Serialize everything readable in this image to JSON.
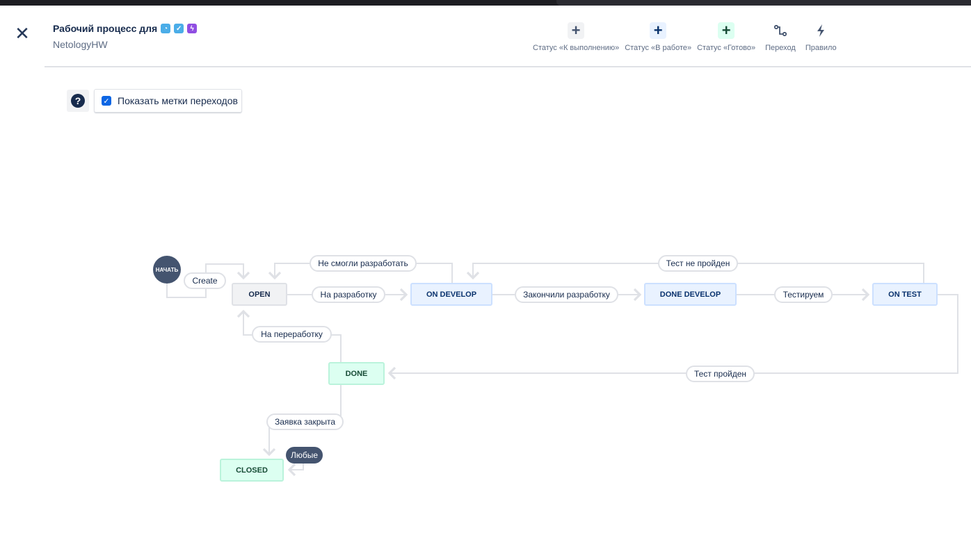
{
  "header": {
    "close_icon": "close-icon",
    "title": "Рабочий процесс для",
    "issue_type_icons": [
      "subtask-icon",
      "task-icon",
      "epic-icon"
    ],
    "project": "NetologyHW"
  },
  "toolbar": [
    {
      "label": "Статус «К выполнению»",
      "icon": "plus-icon",
      "color": "#44546f",
      "bg": "#f1f2f4"
    },
    {
      "label": "Статус «В работе»",
      "icon": "plus-icon",
      "color": "#09326c",
      "bg": "#e9f2ff"
    },
    {
      "label": "Статус «Готово»",
      "icon": "plus-icon",
      "color": "#164b35",
      "bg": "#dcfff1"
    },
    {
      "label": "Переход",
      "icon": "transition-icon"
    },
    {
      "label": "Правило",
      "icon": "lightning-icon"
    }
  ],
  "controls": {
    "help": "?",
    "show_labels": "Показать метки переходов",
    "show_labels_checked": true
  },
  "diagram": {
    "start": "НАЧАТЬ",
    "statuses": {
      "open": "OPEN",
      "on_develop": "ON DEVELOP",
      "done_develop": "DONE DEVELOP",
      "on_test": "ON TEST",
      "done": "DONE",
      "closed": "CLOSED"
    },
    "transitions": {
      "create": "Create",
      "failed_develop": "Не смогли разработать",
      "to_develop": "На разработку",
      "finished_develop": "Закончили разработку",
      "testing": "Тестируем",
      "test_failed": "Тест не пройден",
      "test_passed": "Тест пройден",
      "rework": "На переработку",
      "closed": "Заявка закрыта",
      "any": "Любые"
    }
  }
}
